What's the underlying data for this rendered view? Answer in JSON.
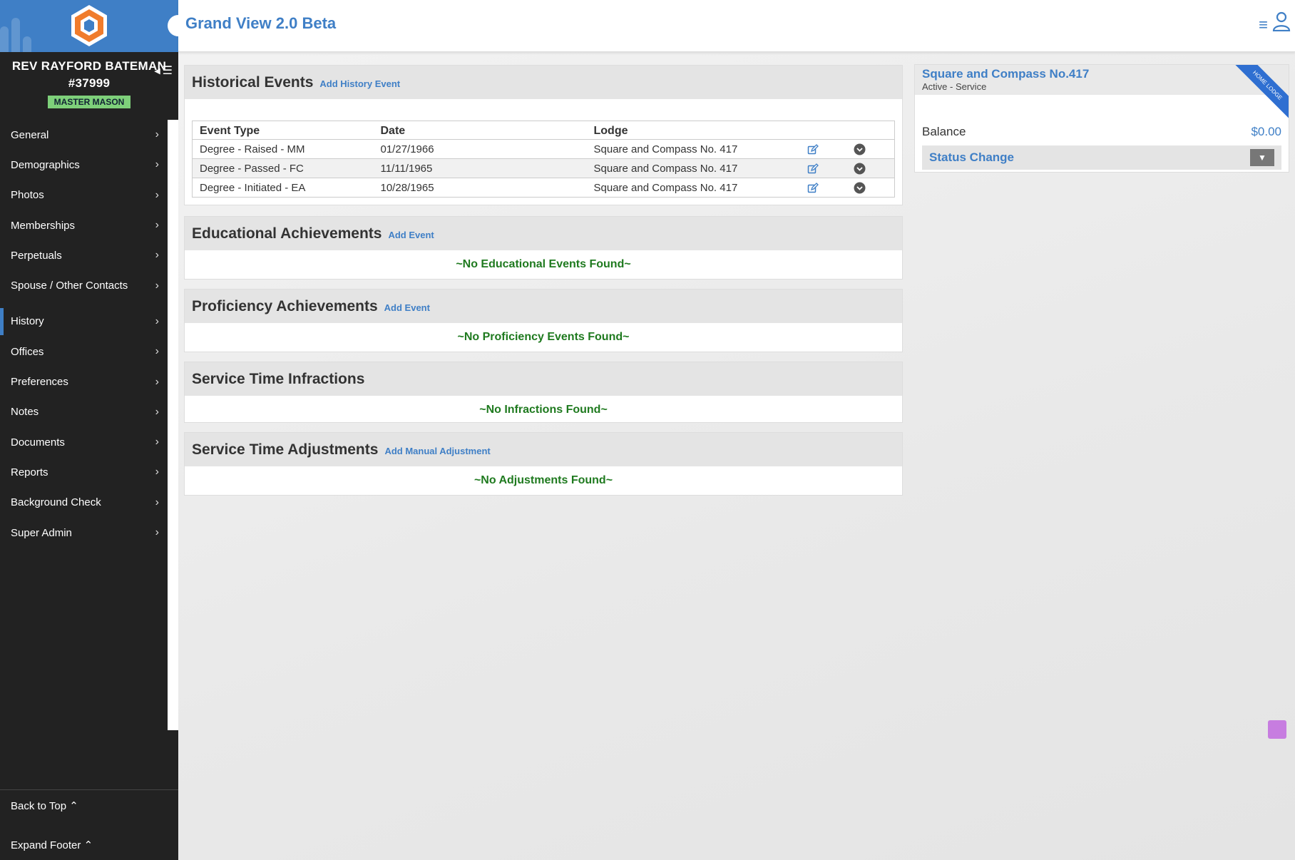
{
  "app": {
    "title": "Grand View 2.0 Beta"
  },
  "member": {
    "name": "REV RAYFORD BATEMAN",
    "number": "#37999",
    "rank_badge": "MASTER MASON"
  },
  "sidebar": {
    "items": [
      {
        "label": "General"
      },
      {
        "label": "Demographics"
      },
      {
        "label": "Photos"
      },
      {
        "label": "Memberships"
      },
      {
        "label": "Perpetuals"
      },
      {
        "label": "Spouse / Other Contacts"
      },
      {
        "label": "History",
        "active": true
      },
      {
        "label": "Offices"
      },
      {
        "label": "Preferences"
      },
      {
        "label": "Notes"
      },
      {
        "label": "Documents"
      },
      {
        "label": "Reports"
      },
      {
        "label": "Background Check"
      },
      {
        "label": "Super Admin"
      }
    ],
    "back_to_top": "Back to Top",
    "expand_footer": "Expand Footer"
  },
  "historical": {
    "title": "Historical Events",
    "action": "Add History Event",
    "columns": [
      "Event Type",
      "Date",
      "Lodge"
    ],
    "rows": [
      {
        "type": "Degree - Raised - MM",
        "date": "01/27/1966",
        "lodge": "Square and Compass No. 417"
      },
      {
        "type": "Degree - Passed - FC",
        "date": "11/11/1965",
        "lodge": "Square and Compass No. 417"
      },
      {
        "type": "Degree - Initiated - EA",
        "date": "10/28/1965",
        "lodge": "Square and Compass No. 417"
      }
    ]
  },
  "educational": {
    "title": "Educational Achievements",
    "action": "Add Event",
    "empty": "~No Educational Events Found~"
  },
  "proficiency": {
    "title": "Proficiency Achievements",
    "action": "Add Event",
    "empty": "~No Proficiency Events Found~"
  },
  "infractions": {
    "title": "Service Time Infractions",
    "empty": "~No Infractions Found~"
  },
  "adjustments": {
    "title": "Service Time Adjustments",
    "action": "Add Manual Adjustment",
    "empty": "~No Adjustments Found~"
  },
  "lodge_card": {
    "lodge_name": "Square and Compass No.417",
    "status": "Active  - Service",
    "ribbon": "HOME LODGE",
    "balance_label": "Balance",
    "balance_value": "$0.00",
    "status_change": "Status Change"
  },
  "colors": {
    "accent": "#3f7fc6",
    "sidebar_bg": "#222222",
    "empty_text": "#1f7a1f",
    "badge": "#7ed07a"
  }
}
